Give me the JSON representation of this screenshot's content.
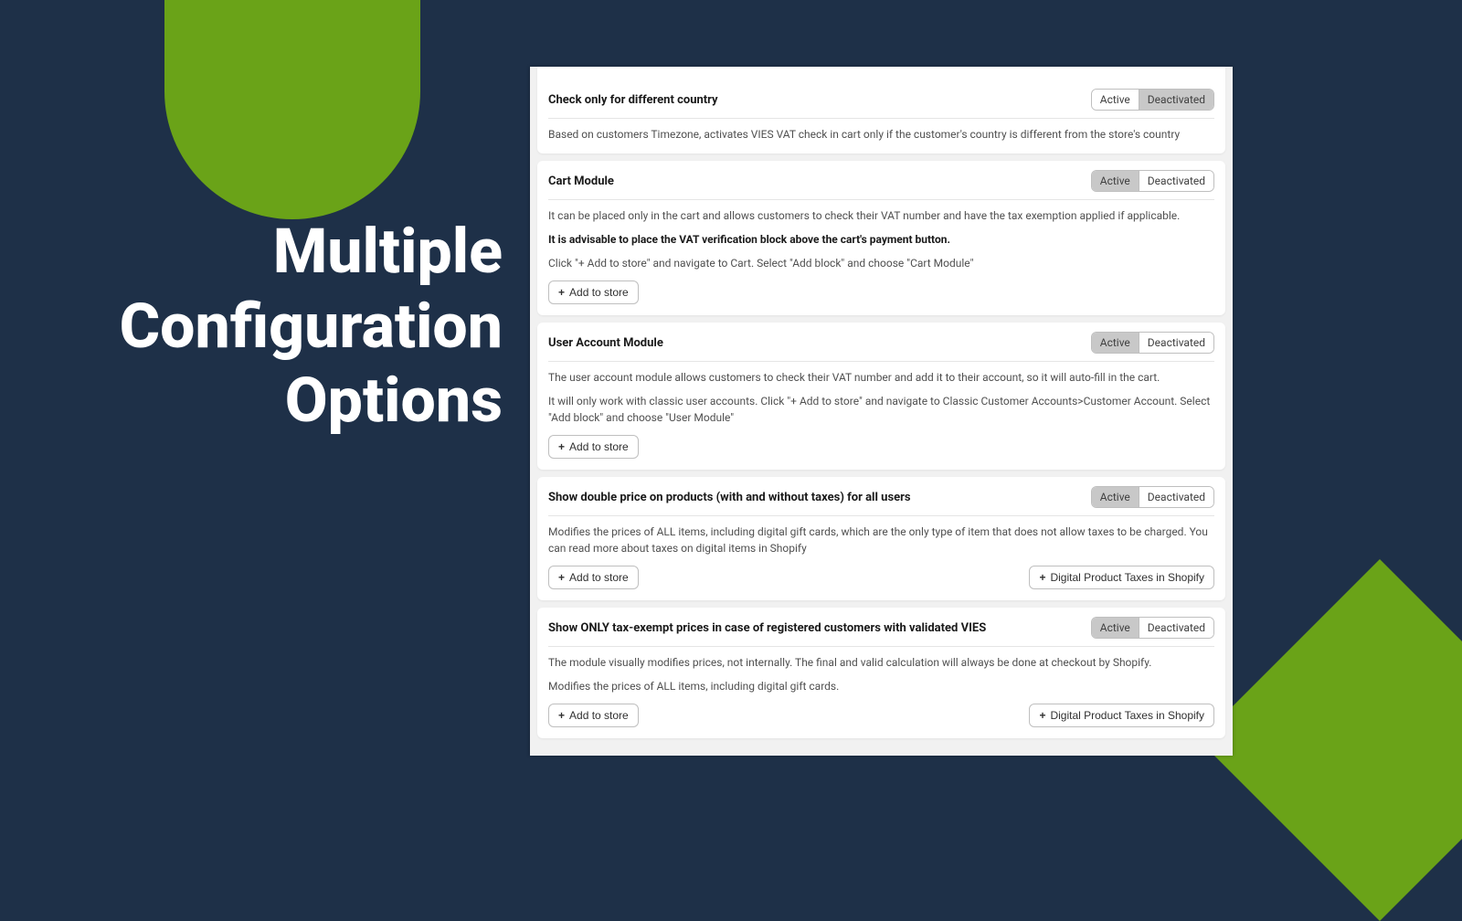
{
  "left_title": "Multiple Configuration Options",
  "toggle": {
    "active": "Active",
    "deactivated": "Deactivated"
  },
  "buttons": {
    "add_to_store": "Add to store",
    "digital_taxes": "Digital Product Taxes in Shopify"
  },
  "cards": [
    {
      "title": "Check only for different country",
      "selected": "deactivated",
      "body": [
        {
          "text": "Based on customers Timezone, activates VIES VAT check in cart only if the customer's country is different from the store's country",
          "bold": false
        }
      ],
      "add_to_store": false,
      "extra_button": false
    },
    {
      "title": "Cart Module",
      "selected": "active",
      "body": [
        {
          "text": "It can be placed only in the cart and allows customers to check their VAT number and have the tax exemption applied if applicable.",
          "bold": false
        },
        {
          "text": "It is advisable to place the VAT verification block above the cart's payment button.",
          "bold": true
        },
        {
          "text": "Click \"+ Add to store\" and navigate to Cart. Select \"Add block\" and choose \"Cart Module\"",
          "bold": false
        }
      ],
      "add_to_store": true,
      "extra_button": false
    },
    {
      "title": "User Account Module",
      "selected": "active",
      "body": [
        {
          "text": "The user account module allows customers to check their VAT number and add it to their account, so it will auto-fill in the cart.",
          "bold": false
        },
        {
          "text": "It will only work with classic user accounts. Click \"+ Add to store\" and navigate to Classic Customer Accounts>Customer Account. Select \"Add block\" and choose \"User Module\"",
          "bold": false
        }
      ],
      "add_to_store": true,
      "extra_button": false
    },
    {
      "title": "Show double price on products (with and without taxes) for all users",
      "selected": "active",
      "body": [
        {
          "text": "Modifies the prices of ALL items, including digital gift cards, which are the only type of item that does not allow taxes to be charged. You can read more about taxes on digital items in Shopify",
          "bold": false
        }
      ],
      "add_to_store": true,
      "extra_button": true
    },
    {
      "title": "Show ONLY tax-exempt prices in case of registered customers with validated VIES",
      "selected": "active",
      "body": [
        {
          "text": "The module visually modifies prices, not internally. The final and valid calculation will always be done at checkout by Shopify.",
          "bold": false
        },
        {
          "text": "Modifies the prices of ALL items, including digital gift cards.",
          "bold": false
        }
      ],
      "add_to_store": true,
      "extra_button": true
    }
  ]
}
